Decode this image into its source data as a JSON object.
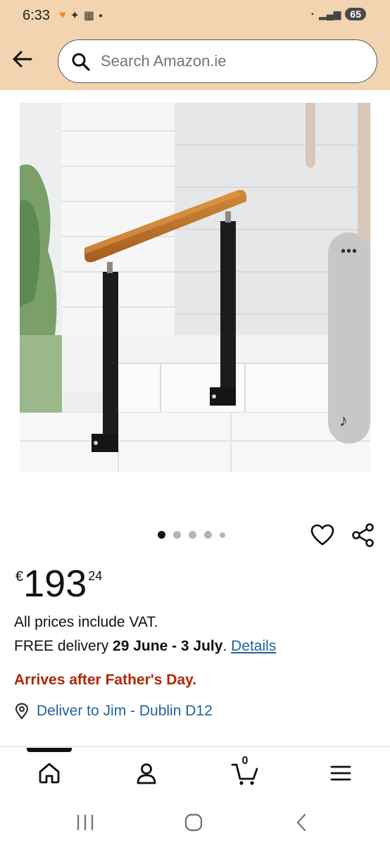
{
  "status_bar": {
    "time": "6:33",
    "battery": "65",
    "left_icons": [
      "heart-badge-icon",
      "app-icon",
      "calendar-icon",
      "dot-icon"
    ],
    "right_icons": [
      "wifi-icon",
      "signal-icon",
      "battery-icon"
    ]
  },
  "header": {
    "search_placeholder": "Search Amazon.ie",
    "background_color": "#f2d5b0"
  },
  "carousel": {
    "total_dots": 5,
    "active_index": 0
  },
  "product": {
    "price_symbol": "€",
    "price_whole": "193",
    "price_fraction": "24",
    "vat_text": "All prices include VAT.",
    "delivery_prefix": "FREE delivery ",
    "delivery_dates": "29 June - 3 July",
    "delivery_suffix": ". ",
    "details_link": "Details",
    "arrives_warning": "Arrives after Father's Day.",
    "deliver_to": "Deliver to Jim - Dublin D12"
  },
  "bottom_nav": {
    "items": [
      "home-icon",
      "account-icon",
      "cart-icon",
      "menu-icon"
    ],
    "cart_count": "0",
    "active": "home-icon"
  },
  "colors": {
    "link": "#2162a1",
    "warning": "#b12704"
  }
}
